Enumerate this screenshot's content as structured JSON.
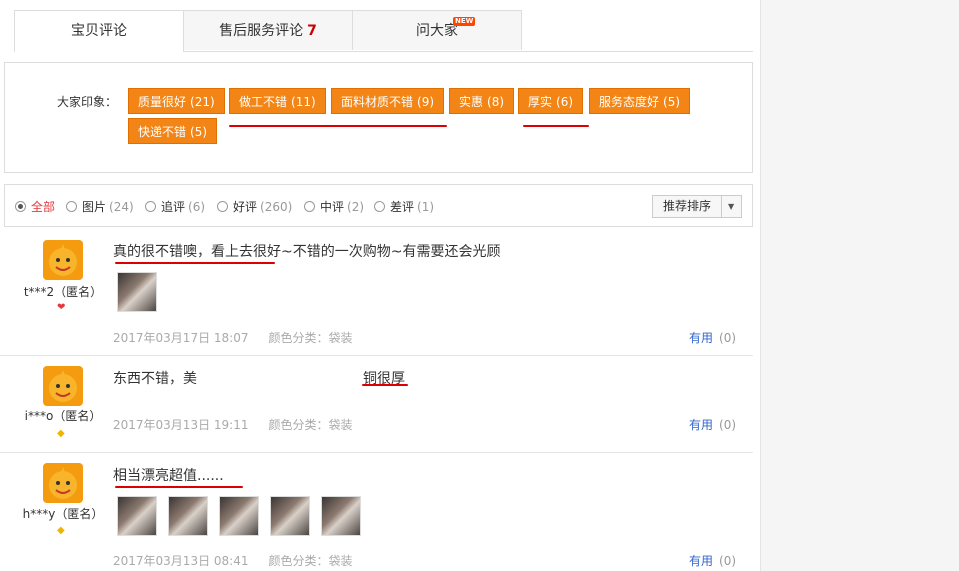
{
  "tabs": [
    {
      "label": "宝贝评论",
      "count": "",
      "active": true
    },
    {
      "label": "售后服务评论",
      "count": "7",
      "active": false
    },
    {
      "label": "问大家",
      "count": "",
      "badge": "NEW",
      "active": false
    }
  ],
  "impressions": {
    "label": "大家印象：",
    "tags": [
      {
        "text": "质量很好",
        "count": "(21)"
      },
      {
        "text": "做工不错",
        "count": "(11)"
      },
      {
        "text": "面料材质不错",
        "count": "(9)"
      },
      {
        "text": "实惠",
        "count": "(8)"
      },
      {
        "text": "厚实",
        "count": "(6)"
      },
      {
        "text": "服务态度好",
        "count": "(5)"
      },
      {
        "text": "快递不错",
        "count": "(5)"
      }
    ]
  },
  "filters": [
    {
      "label": "全部",
      "count": "",
      "selected": true
    },
    {
      "label": "图片",
      "count": "(24)",
      "selected": false
    },
    {
      "label": "追评",
      "count": "(6)",
      "selected": false
    },
    {
      "label": "好评",
      "count": "(260)",
      "selected": false
    },
    {
      "label": "中评",
      "count": "(2)",
      "selected": false
    },
    {
      "label": "差评",
      "count": "(1)",
      "selected": false
    }
  ],
  "sort": {
    "label": "推荐排序"
  },
  "reviews": [
    {
      "user": "t***2（匿名）",
      "content": "真的很不错噢，看上去很好~不错的一次购物~有需要还会光顾",
      "content2": "",
      "date": "2017年03月17日 18:07",
      "spec": "颜色分类：袋装",
      "useful": "有用",
      "useful_count": "(0)"
    },
    {
      "user": "i***o（匿名）",
      "content": "东西不错，美",
      "content2": "铜很厚",
      "date": "2017年03月13日 19:11",
      "spec": "颜色分类：袋装",
      "useful": "有用",
      "useful_count": "(0)"
    },
    {
      "user": "h***y（匿名）",
      "content": "相当漂亮超值......",
      "content2": "",
      "date": "2017年03月13日 08:41",
      "spec": "颜色分类：袋装",
      "useful": "有用",
      "useful_count": "(0)"
    }
  ],
  "colors": {
    "accent": "#f28515",
    "brand_red": "#e4393c",
    "link": "#3366cc"
  }
}
